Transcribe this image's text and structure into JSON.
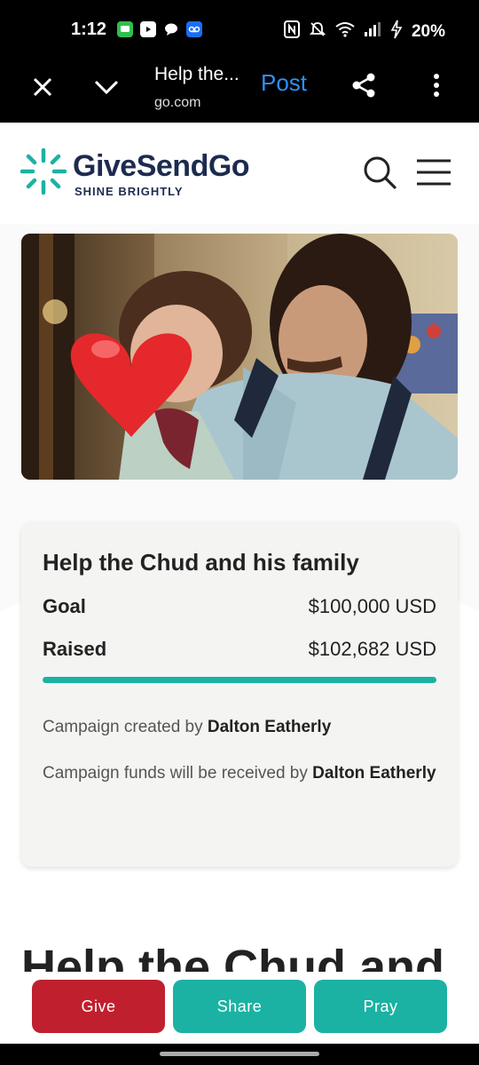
{
  "status_bar": {
    "time": "1:12",
    "battery": "20%"
  },
  "browser": {
    "title": "Help the...",
    "url": "go.com",
    "post_label": "Post"
  },
  "site": {
    "logo_name": "GiveSendGo",
    "logo_tagline": "SHINE BRIGHTLY"
  },
  "campaign": {
    "title": "Help the Chud and his family",
    "goal_label": "Goal",
    "goal_value": "$100,000 USD",
    "raised_label": "Raised",
    "raised_value": "$102,682 USD",
    "progress_fraction": 1.0,
    "created_prefix": "Campaign created by ",
    "creator_name": "Dalton Eatherly",
    "received_prefix": "Campaign funds will be received by ",
    "recipient_name": "Dalton Eatherly"
  },
  "content": {
    "heading": "Help the Chud and"
  },
  "actions": {
    "give": "Give",
    "share": "Share",
    "pray": "Pray"
  },
  "colors": {
    "accent": "#1bb2a3",
    "give": "#c0202e",
    "post_link": "#2f8ff1",
    "brand_navy": "#1d2b4f"
  }
}
